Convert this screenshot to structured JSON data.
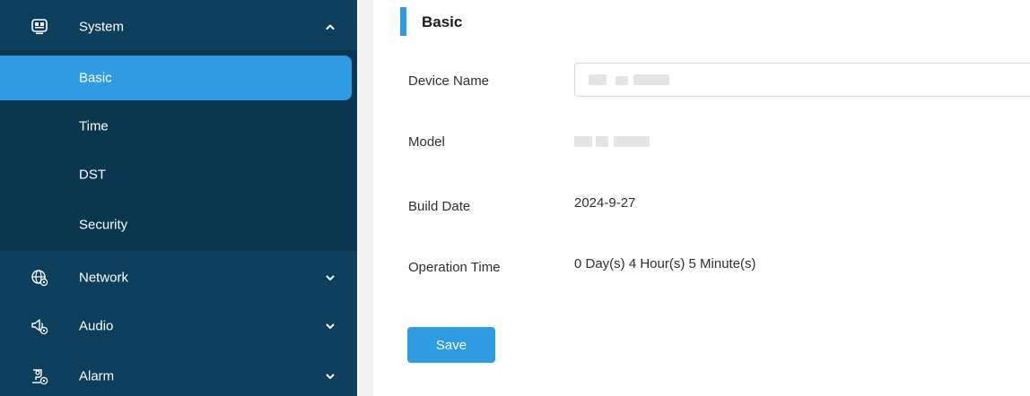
{
  "sidebar": {
    "system": {
      "label": "System",
      "icon": "monitor-icon",
      "expanded": true
    },
    "sub_items": [
      {
        "label": "Basic",
        "active": true
      },
      {
        "label": "Time",
        "active": false
      },
      {
        "label": "DST",
        "active": false
      },
      {
        "label": "Security",
        "active": false
      }
    ],
    "network": {
      "label": "Network",
      "icon": "globe-gear-icon"
    },
    "audio": {
      "label": "Audio",
      "icon": "speaker-gear-icon"
    },
    "alarm": {
      "label": "Alarm",
      "icon": "alarm-user-gear-icon"
    }
  },
  "main": {
    "section_title": "Basic",
    "fields": {
      "device_name": {
        "label": "Device Name",
        "value": ""
      },
      "model": {
        "label": "Model",
        "value": ""
      },
      "build_date": {
        "label": "Build Date",
        "value": "2024-9-27"
      },
      "operation_time": {
        "label": "Operation Time",
        "value": "0 Day(s) 4 Hour(s) 5 Minute(s)"
      }
    },
    "save_label": "Save"
  },
  "colors": {
    "sidebar_bg": "#0d3e5c",
    "submenu_bg": "#0b3650",
    "accent": "#2f9be0"
  }
}
